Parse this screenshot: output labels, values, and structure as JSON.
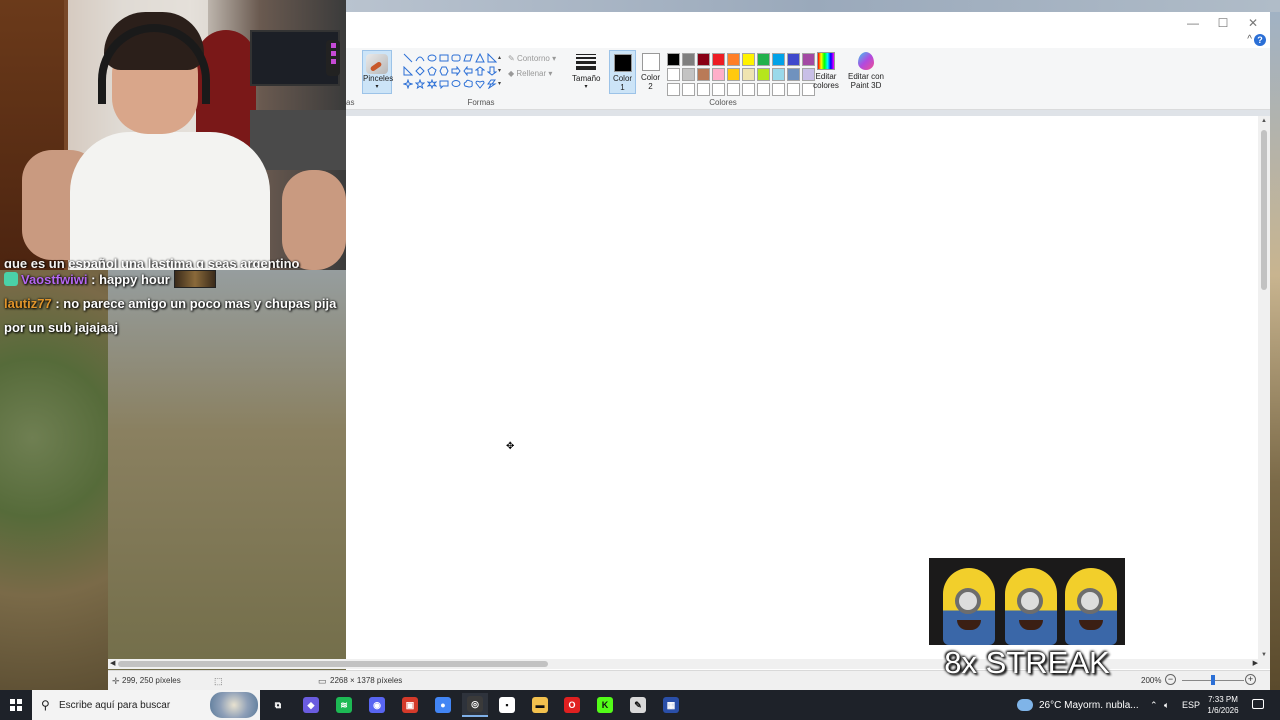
{
  "paint": {
    "tools_partial_label": "as",
    "brushes_label": "Pinceles",
    "shapes_group_label": "Formas",
    "contour_label": "Contorno",
    "fill_label": "Rellenar",
    "size_label": "Tamaño",
    "color1_label": "Color\n1",
    "color2_label": "Color\n2",
    "color1_value": "#000000",
    "color2_value": "#ffffff",
    "colors_group_label": "Colores",
    "edit_colors_label": "Editar colores",
    "edit_3d_label": "Editar con Paint 3D",
    "palette": [
      "#000000",
      "#7f7f7f",
      "#880015",
      "#ed1c24",
      "#ff7f27",
      "#fff200",
      "#22b14c",
      "#00a2e8",
      "#3f48cc",
      "#a349a4",
      "#ffffff",
      "#c3c3c3",
      "#b97a57",
      "#ffaec9",
      "#ffc90e",
      "#efe4b0",
      "#b5e61d",
      "#99d9ea",
      "#7092be",
      "#c8bfe7",
      "#ffffff",
      "#ffffff",
      "#ffffff",
      "#ffffff",
      "#ffffff",
      "#ffffff",
      "#ffffff",
      "#ffffff",
      "#ffffff",
      "#ffffff"
    ],
    "status": {
      "cursor_position": "299, 250 píxeles",
      "image_size": "2268 × 1378 píxeles",
      "zoom": "200%",
      "zoom_minus": "−",
      "zoom_plus": "+"
    },
    "window_controls": {
      "minimize": "—",
      "maximize": "☐",
      "close": "✕",
      "collapse": "^",
      "help": "?"
    }
  },
  "chat": {
    "partial_line": "que es un español una lastima q seas argentino",
    "messages": [
      {
        "user": "Vaostfwiwi",
        "sep": ":",
        "text": "happy hour"
      },
      {
        "user": "lautiz77",
        "sep": ":",
        "text": "no parece amigo un poco mas y chupas pija por un sub jajajaaj"
      }
    ]
  },
  "overlay": {
    "streak_text": "8x STREAK"
  },
  "taskbar": {
    "search_placeholder": "Escribe aquí para buscar",
    "weather": "26°C  Mayorm. nubla...",
    "language": "ESP",
    "time": "7:33 PM",
    "date": "1/6/2026",
    "apps": [
      {
        "name": "task-view",
        "color": "#1e2229",
        "glyph": "⧉"
      },
      {
        "name": "copilot",
        "color": "#6a5ce0",
        "glyph": "◆"
      },
      {
        "name": "spotify",
        "color": "#1db954",
        "glyph": "≋"
      },
      {
        "name": "discord",
        "color": "#5865f2",
        "glyph": "◉"
      },
      {
        "name": "stream-app",
        "color": "#d43a2a",
        "glyph": "▣"
      },
      {
        "name": "chrome",
        "color": "#4285f4",
        "glyph": "●"
      },
      {
        "name": "obs",
        "color": "#3a3a3a",
        "glyph": "◎"
      },
      {
        "name": "epic",
        "color": "#ffffff",
        "glyph": "▪"
      },
      {
        "name": "file-explorer",
        "color": "#f2c14e",
        "glyph": "▬"
      },
      {
        "name": "opera",
        "color": "#e02020",
        "glyph": "O"
      },
      {
        "name": "kick",
        "color": "#53fc18",
        "glyph": "K"
      },
      {
        "name": "paint",
        "color": "#d9d9d9",
        "glyph": "✎"
      },
      {
        "name": "calculator",
        "color": "#2a4fa8",
        "glyph": "▦"
      }
    ]
  }
}
